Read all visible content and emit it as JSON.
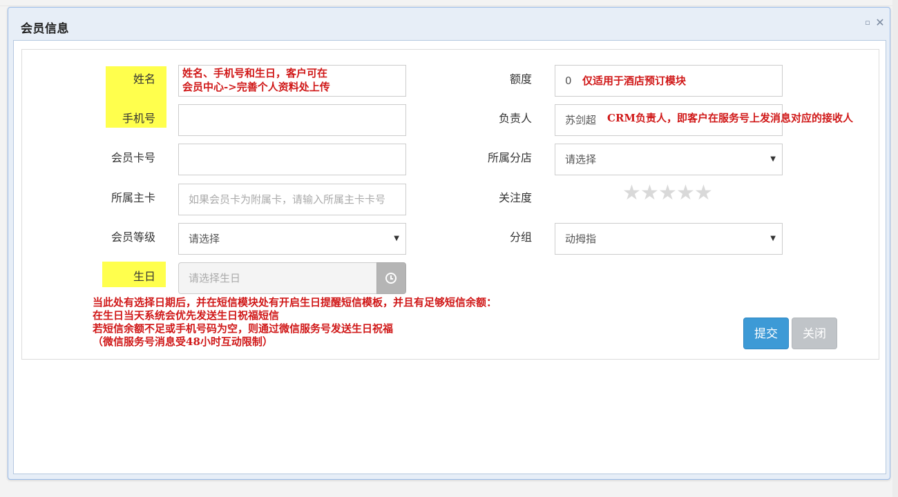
{
  "dialog": {
    "title": "会员信息",
    "maximize_glyph": "▫",
    "close_glyph": "✕"
  },
  "form": {
    "name_label": "姓名",
    "phone_label": "手机号",
    "card_label": "会员卡号",
    "main_card_label": "所属主卡",
    "main_card_placeholder": "如果会员卡为附属卡，请输入所属主卡卡号",
    "level_label": "会员等级",
    "level_value": "请选择",
    "birthday_label": "生日",
    "birthday_placeholder": "请选择生日",
    "quota_label": "额度",
    "quota_value": "0",
    "owner_label": "负责人",
    "owner_value": "苏剑超",
    "branch_label": "所属分店",
    "branch_value": "请选择",
    "attention_label": "关注度",
    "attention_rating": 0,
    "attention_max": 5,
    "group_label": "分组",
    "group_value": "动拇指"
  },
  "notes": {
    "name_line1": "姓名、手机号和生日，客户可在",
    "name_line2": "会员中心->完善个人资料处上传",
    "quota": "仅适用于酒店预订模块",
    "owner": "CRM负责人，即客户在服务号上发消息对应的接收人",
    "birthday_line1": "当此处有选择日期后，并在短信模块处有开启生日提醒短信模板，并且有足够短信余额：",
    "birthday_line2": "在生日当天系统会优先发送生日祝福短信",
    "birthday_line3": "若短信余额不足或手机号码为空，则通过微信服务号发送生日祝福",
    "birthday_line4": "（微信服务号消息受48小时互动限制）"
  },
  "buttons": {
    "submit": "提交",
    "close": "关闭"
  },
  "colors": {
    "highlight": "#ffff4d",
    "note_red": "#d01818",
    "submit_blue": "#3d9ad6",
    "close_gray": "#c0c4c8"
  }
}
